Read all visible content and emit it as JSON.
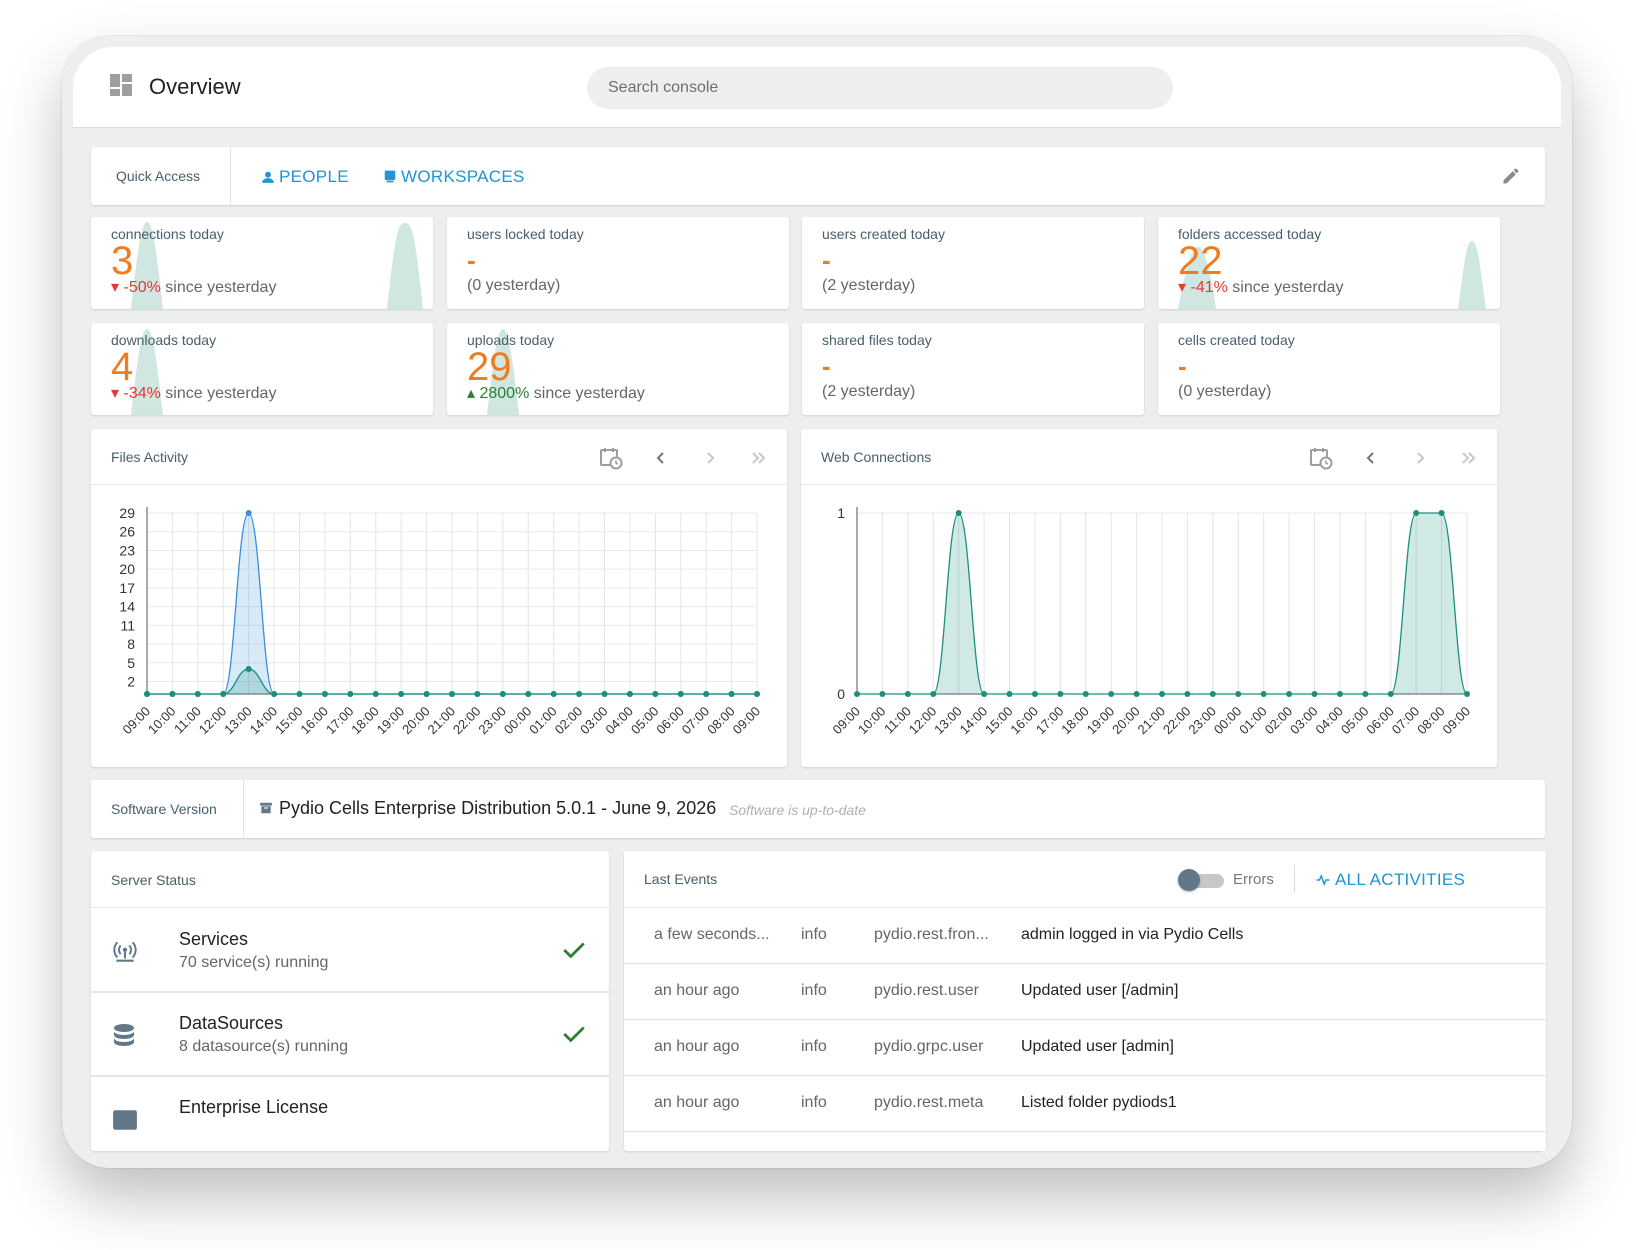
{
  "header": {
    "title": "Overview",
    "search_placeholder": "Search console"
  },
  "quick_access": {
    "label": "Quick Access",
    "people": "PEOPLE",
    "workspaces": "WORKSPACES"
  },
  "stats": [
    {
      "title": "connections today",
      "value": "3",
      "delta": "-50%",
      "delta_dir": "down",
      "delta_text": " since yesterday"
    },
    {
      "title": "users locked today",
      "value": "-",
      "sub": "(0 yesterday)"
    },
    {
      "title": "users created today",
      "value": "-",
      "sub": "(2 yesterday)"
    },
    {
      "title": "folders accessed today",
      "value": "22",
      "delta": "-41%",
      "delta_dir": "down",
      "delta_text": " since yesterday"
    },
    {
      "title": "downloads today",
      "value": "4",
      "delta": "-34%",
      "delta_dir": "down",
      "delta_text": " since yesterday"
    },
    {
      "title": "uploads today",
      "value": "29",
      "delta": "2800%",
      "delta_dir": "up",
      "delta_text": " since yesterday"
    },
    {
      "title": "shared files today",
      "value": "-",
      "sub": "(2 yesterday)"
    },
    {
      "title": "cells created today",
      "value": "-",
      "sub": "(0 yesterday)"
    }
  ],
  "chart_data": [
    {
      "type": "area",
      "title": "Files Activity",
      "x": [
        "09:00",
        "10:00",
        "11:00",
        "12:00",
        "13:00",
        "14:00",
        "15:00",
        "16:00",
        "17:00",
        "18:00",
        "19:00",
        "20:00",
        "21:00",
        "22:00",
        "23:00",
        "00:00",
        "01:00",
        "02:00",
        "03:00",
        "04:00",
        "05:00",
        "06:00",
        "07:00",
        "08:00",
        "09:00"
      ],
      "yticks": [
        2,
        5,
        8,
        11,
        14,
        17,
        20,
        23,
        26,
        29
      ],
      "ylim": [
        0,
        29
      ],
      "series": [
        {
          "color": "#3a8fd8",
          "values": [
            0,
            0,
            0,
            0,
            29,
            0,
            0,
            0,
            0,
            0,
            0,
            0,
            0,
            0,
            0,
            0,
            0,
            0,
            0,
            0,
            0,
            0,
            0,
            0,
            0
          ]
        },
        {
          "color": "#1a8f7d",
          "values": [
            0,
            0,
            0,
            0,
            4,
            0,
            0,
            0,
            0,
            0,
            0,
            0,
            0,
            0,
            0,
            0,
            0,
            0,
            0,
            0,
            0,
            0,
            0,
            0,
            0
          ]
        }
      ],
      "grid": true
    },
    {
      "type": "area",
      "title": "Web Connections",
      "x": [
        "09:00",
        "10:00",
        "11:00",
        "12:00",
        "13:00",
        "14:00",
        "15:00",
        "16:00",
        "17:00",
        "18:00",
        "19:00",
        "20:00",
        "21:00",
        "22:00",
        "23:00",
        "00:00",
        "01:00",
        "02:00",
        "03:00",
        "04:00",
        "05:00",
        "06:00",
        "07:00",
        "08:00",
        "09:00"
      ],
      "yticks": [
        0,
        1
      ],
      "ylim": [
        0,
        1
      ],
      "series": [
        {
          "color": "#1a8f7d",
          "values": [
            0,
            0,
            0,
            0,
            1,
            0,
            0,
            0,
            0,
            0,
            0,
            0,
            0,
            0,
            0,
            0,
            0,
            0,
            0,
            0,
            0,
            0,
            1,
            1,
            0
          ]
        }
      ],
      "grid": true
    }
  ],
  "version": {
    "label": "Software Version",
    "text": "Pydio Cells Enterprise Distribution 5.0.1 - June 9, 2026",
    "status": "Software is up-to-date"
  },
  "server_status": {
    "title": "Server Status",
    "rows": [
      {
        "title": "Services",
        "sub": "70 service(s) running",
        "icon": "broadcast-icon"
      },
      {
        "title": "DataSources",
        "sub": "8 datasource(s) running",
        "icon": "database-icon"
      },
      {
        "title": "Enterprise License",
        "sub": "",
        "icon": "license-icon"
      }
    ]
  },
  "events": {
    "title": "Last Events",
    "errors_label": "Errors",
    "all_label": "ALL ACTIVITIES",
    "rows": [
      {
        "time": "a few seconds...",
        "level": "info",
        "source": "pydio.rest.fron...",
        "msg": "admin logged in via Pydio Cells"
      },
      {
        "time": "an hour ago",
        "level": "info",
        "source": "pydio.rest.user",
        "msg": "Updated user [/admin]"
      },
      {
        "time": "an hour ago",
        "level": "info",
        "source": "pydio.grpc.user",
        "msg": "Updated user [admin]"
      },
      {
        "time": "an hour ago",
        "level": "info",
        "source": "pydio.rest.meta",
        "msg": "Listed folder pydiods1"
      }
    ]
  },
  "colors": {
    "accent": "#1e95d4",
    "stat_value": "#ee7d22",
    "negative": "#e53935",
    "positive": "#2e7d32",
    "spark": "#cfe6e1"
  }
}
